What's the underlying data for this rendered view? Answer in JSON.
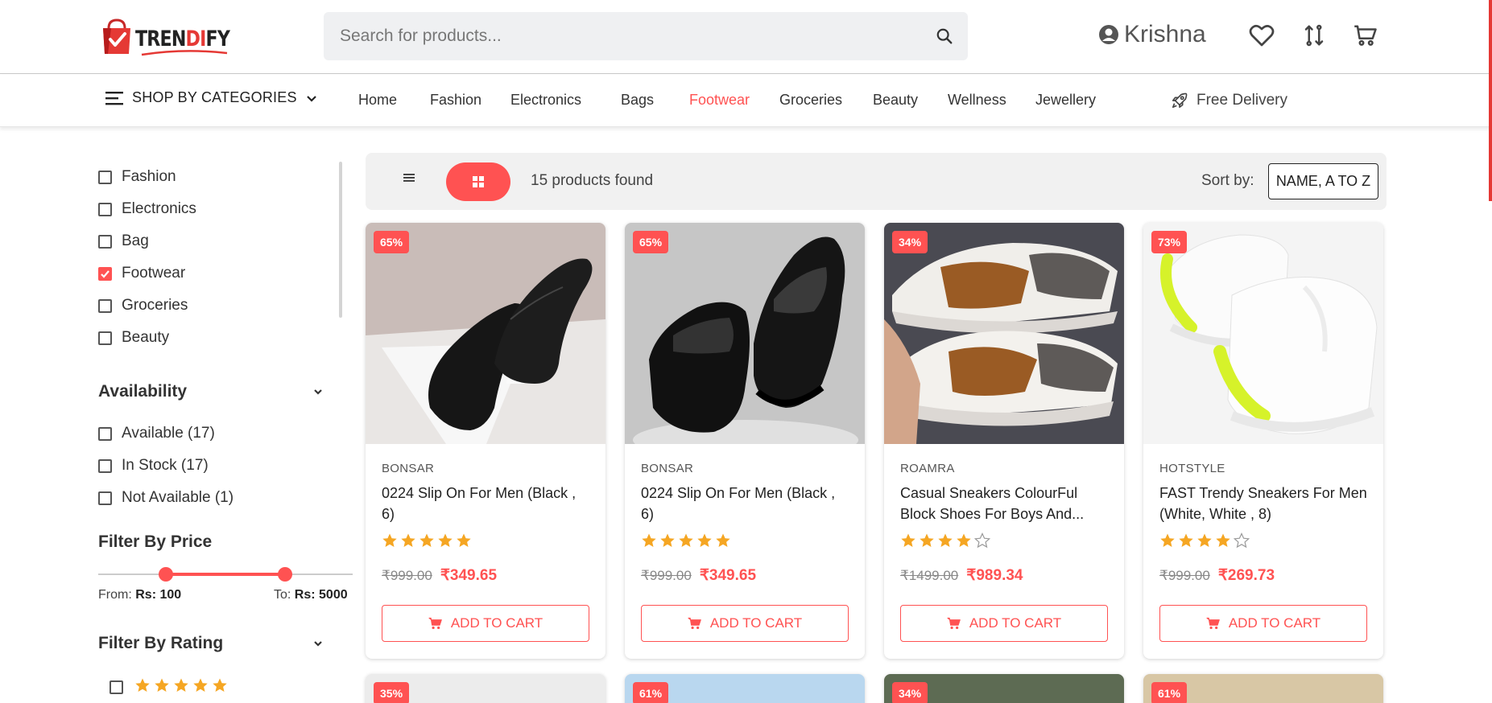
{
  "brand": {
    "logo_text_dark_1": "TREN",
    "logo_text_red": "DI",
    "logo_text_dark_2": "FY"
  },
  "search": {
    "placeholder": "Search for products..."
  },
  "header": {
    "user_name": "Krishna",
    "icons": [
      "user-icon",
      "heart-icon",
      "compare-icon",
      "cart-icon"
    ]
  },
  "nav": {
    "categories_label": "SHOP BY CATEGORIES",
    "links": [
      "Home",
      "Fashion",
      "Electronics",
      "Bags",
      "Footwear",
      "Groceries",
      "Beauty",
      "Wellness",
      "Jewellery"
    ],
    "active": "Footwear",
    "free_delivery": "Free Delivery"
  },
  "filters": {
    "categories": [
      {
        "label": "Fashion",
        "checked": false
      },
      {
        "label": "Electronics",
        "checked": false
      },
      {
        "label": "Bag",
        "checked": false
      },
      {
        "label": "Footwear",
        "checked": true
      },
      {
        "label": "Groceries",
        "checked": false
      },
      {
        "label": "Beauty",
        "checked": false
      }
    ],
    "availability_title": "Availability",
    "availability": [
      {
        "label": "Available (17)",
        "checked": false
      },
      {
        "label": "In Stock (17)",
        "checked": false
      },
      {
        "label": "Not Available (1)",
        "checked": false
      }
    ],
    "price_title": "Filter By Price",
    "price_from_label": "From:",
    "price_from_value": "Rs: 100",
    "price_to_label": "To:",
    "price_to_value": "Rs: 5000",
    "rating_title": "Filter By Rating",
    "rating_first_row_stars": 5
  },
  "toolbar": {
    "count": "15 products found",
    "sort_label": "Sort by:",
    "sort_value": "NAME, A TO Z"
  },
  "products": [
    {
      "discount": "65%",
      "brand": "BONSAR",
      "title": "0224 Slip On For Men (Black , 6)",
      "rating": 5,
      "old_price": "₹999.00",
      "new_price": "₹349.65",
      "cta": "ADD TO CART"
    },
    {
      "discount": "65%",
      "brand": "BONSAR",
      "title": "0224 Slip On For Men (Black , 6)",
      "rating": 5,
      "old_price": "₹999.00",
      "new_price": "₹349.65",
      "cta": "ADD TO CART"
    },
    {
      "discount": "34%",
      "brand": "ROAMRA",
      "title": "Casual Sneakers ColourFul Block Shoes For Boys And...",
      "rating": 4,
      "old_price": "₹1499.00",
      "new_price": "₹989.34",
      "cta": "ADD TO CART"
    },
    {
      "discount": "73%",
      "brand": "HOTSTYLE",
      "title": "FAST Trendy Sneakers For Men (White, White , 8)",
      "rating": 4,
      "old_price": "₹999.00",
      "new_price": "₹269.73",
      "cta": "ADD TO CART"
    }
  ],
  "next_row_discounts": [
    "35%",
    "61%",
    "34%",
    "61%"
  ],
  "colors": {
    "accent": "#ff5252",
    "star": "#f5a623"
  }
}
